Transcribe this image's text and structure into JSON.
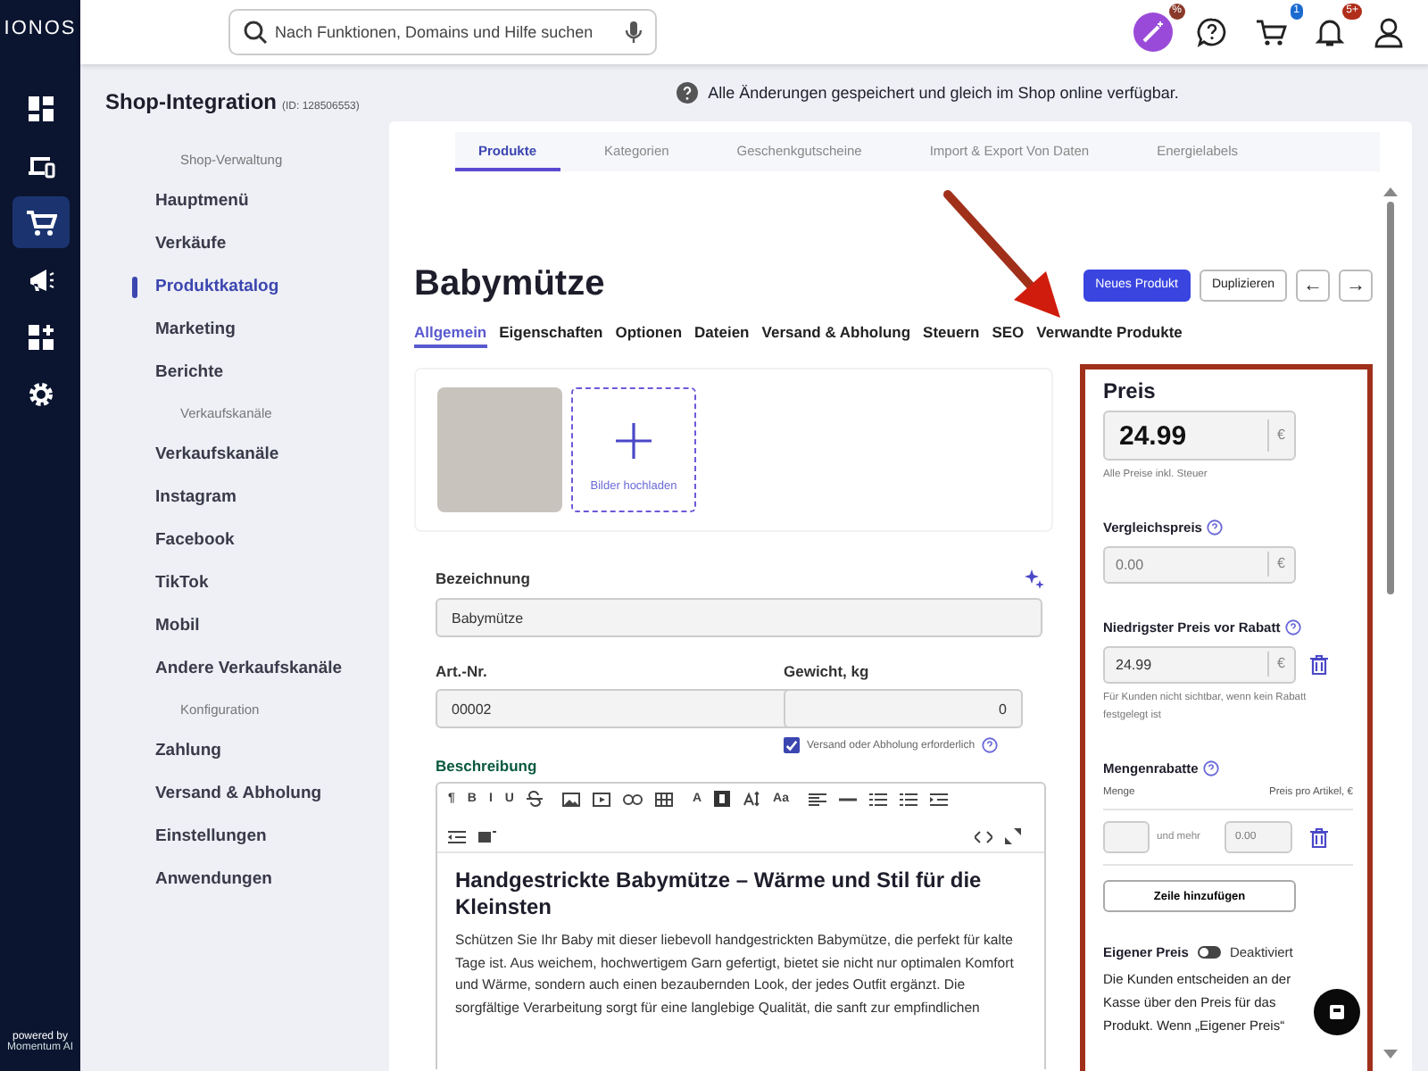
{
  "logo": "IONOS",
  "rail": {
    "items": [
      {
        "selected": false
      },
      {
        "selected": false
      },
      {
        "selected": true
      },
      {
        "selected": false
      },
      {
        "selected": false
      },
      {
        "selected": false
      }
    ],
    "powered_by": "powered by",
    "brand": "Momentum AI"
  },
  "header": {
    "search": {
      "placeholder": "Nach Funktionen, Domains und Hilfe suchen"
    },
    "badges": {
      "promo": "%",
      "cart": "1",
      "notifications": "5+"
    }
  },
  "sidebar": {
    "title": "Shop-Integration",
    "id": "(ID: 128506553)",
    "sections": [
      {
        "heading": "Shop-Verwaltung",
        "items": [
          {
            "label": "Hauptmenü",
            "selected": false
          },
          {
            "label": "Verkäufe",
            "selected": false
          },
          {
            "label": "Produktkatalog",
            "selected": true
          },
          {
            "label": "Marketing",
            "selected": false
          },
          {
            "label": "Berichte",
            "selected": false
          }
        ]
      },
      {
        "heading": "Verkaufskanäle",
        "items": [
          {
            "label": "Verkaufskanäle",
            "selected": false
          },
          {
            "label": "Instagram",
            "selected": false
          },
          {
            "label": "Facebook",
            "selected": false
          },
          {
            "label": "TikTok",
            "selected": false
          },
          {
            "label": "Mobil",
            "selected": false
          },
          {
            "label": "Andere Verkaufskanäle",
            "selected": false
          }
        ]
      },
      {
        "heading": "Konfiguration",
        "items": [
          {
            "label": "Zahlung",
            "selected": false
          },
          {
            "label": "Versand & Abholung",
            "selected": false
          },
          {
            "label": "Einstellungen",
            "selected": false
          },
          {
            "label": "Anwendungen",
            "selected": false
          }
        ]
      }
    ]
  },
  "info": "Alle Änderungen gespeichert und gleich im Shop online verfügbar.",
  "top_tabs": [
    {
      "label": "Produkte",
      "selected": true
    },
    {
      "label": "Kategorien",
      "selected": false
    },
    {
      "label": "Geschenkgutscheine",
      "selected": false
    },
    {
      "label": "Import & Export Von Daten",
      "selected": false
    },
    {
      "label": "Energielabels",
      "selected": false
    }
  ],
  "product": {
    "title": "Babymütze",
    "buttons": {
      "new": "Neues Produkt",
      "duplicate": "Duplizieren",
      "prev": "←",
      "next": "→"
    },
    "tabs": [
      {
        "label": "Allgemein",
        "selected": true
      },
      {
        "label": "Eigenschaften",
        "selected": false
      },
      {
        "label": "Optionen",
        "selected": false
      },
      {
        "label": "Dateien",
        "selected": false
      },
      {
        "label": "Versand & Abholung",
        "selected": false
      },
      {
        "label": "Steuern",
        "selected": false
      },
      {
        "label": "SEO",
        "selected": false
      },
      {
        "label": "Verwandte Produkte",
        "selected": false
      }
    ],
    "upload": "Bilder hochladen",
    "name": {
      "label": "Bezeichnung",
      "value": "Babymütze"
    },
    "sku": {
      "label": "Art.-Nr.",
      "value": "00002"
    },
    "weight": {
      "label": "Gewicht, kg",
      "value": "0"
    },
    "shipping": {
      "label": "Versand oder Abholung erforderlich",
      "checked": true
    },
    "description": {
      "label": "Beschreibung",
      "toolbar": [
        {
          "kind": "text",
          "label": "¶"
        },
        {
          "kind": "text",
          "label": "B"
        },
        {
          "kind": "text",
          "label": "I"
        },
        {
          "kind": "text",
          "label": "U"
        },
        {
          "kind": "strike"
        },
        {
          "kind": "gap"
        },
        {
          "kind": "image"
        },
        {
          "kind": "video"
        },
        {
          "kind": "link"
        },
        {
          "kind": "table"
        },
        {
          "kind": "gap"
        },
        {
          "kind": "text",
          "label": "A"
        },
        {
          "kind": "fill"
        },
        {
          "kind": "size"
        },
        {
          "kind": "text",
          "label": "Aa"
        },
        {
          "kind": "gap"
        },
        {
          "kind": "align"
        },
        {
          "kind": "rule"
        },
        {
          "kind": "list"
        },
        {
          "kind": "list"
        },
        {
          "kind": "indent"
        },
        {
          "kind": "break"
        },
        {
          "kind": "outdent"
        },
        {
          "kind": "block"
        },
        {
          "kind": "spacer"
        },
        {
          "kind": "code"
        },
        {
          "kind": "expand"
        }
      ],
      "heading": "Handgestrickte Babymütze – Wärme und Stil für die Kleinsten",
      "body": "Schützen Sie Ihr Baby mit dieser liebevoll handgestrickten Babymütze, die perfekt für kalte Tage ist. Aus weichem, hochwertigem Garn gefertigt, bietet sie nicht nur optimalen Komfort und Wärme, sondern auch einen bezaubernden Look, der jedes Outfit ergänzt. Die sorgfältige Verarbeitung sorgt für eine langlebige Qualität, die sanft zur empfindlichen"
    }
  },
  "price": {
    "title": "Preis",
    "value": "24.99",
    "currency": "€",
    "note": "Alle Preise inkl. Steuer",
    "compare": {
      "label": "Vergleichspreis",
      "placeholder": "0.00",
      "currency": "€"
    },
    "lowest": {
      "label": "Niedrigster Preis vor Rabatt",
      "value": "24.99",
      "currency": "€",
      "note": "Für Kunden nicht sichtbar, wenn kein Rabatt festgelegt ist"
    },
    "bulk": {
      "label": "Mengenrabatte",
      "col_qty": "Menge",
      "col_price": "Preis pro Artikel, €",
      "and_more": "und mehr",
      "placeholder": "0.00",
      "add": "Zeile hinzufügen"
    },
    "custom": {
      "label": "Eigener Preis",
      "on": false,
      "state": "Deaktiviert",
      "text": "Die Kunden entscheiden an der Kasse über den Preis für das Produkt. Wenn „Eigener Preis“"
    }
  }
}
